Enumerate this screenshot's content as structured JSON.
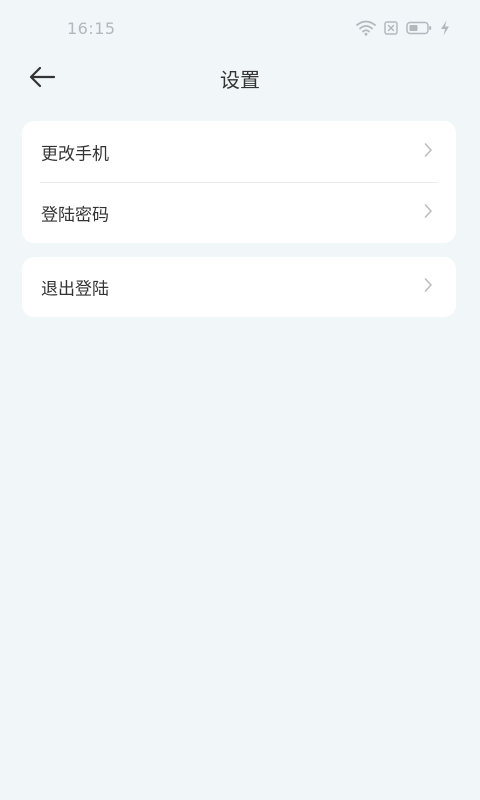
{
  "status_bar": {
    "time": "16:15",
    "icons": [
      "wifi-icon",
      "sim-error-icon",
      "battery-icon",
      "charging-bolt-icon"
    ]
  },
  "nav": {
    "back_icon": "arrow-left-icon",
    "title": "设置"
  },
  "settings_groups": [
    {
      "items": [
        {
          "label": "更改手机",
          "icon": "chevron-right-icon"
        },
        {
          "label": "登陆密码",
          "icon": "chevron-right-icon"
        }
      ]
    },
    {
      "items": [
        {
          "label": "退出登陆",
          "icon": "chevron-right-icon"
        }
      ]
    }
  ],
  "colors": {
    "background": "#f1f6f9",
    "card": "#ffffff",
    "text": "#333333",
    "muted": "#b3b8bd"
  }
}
